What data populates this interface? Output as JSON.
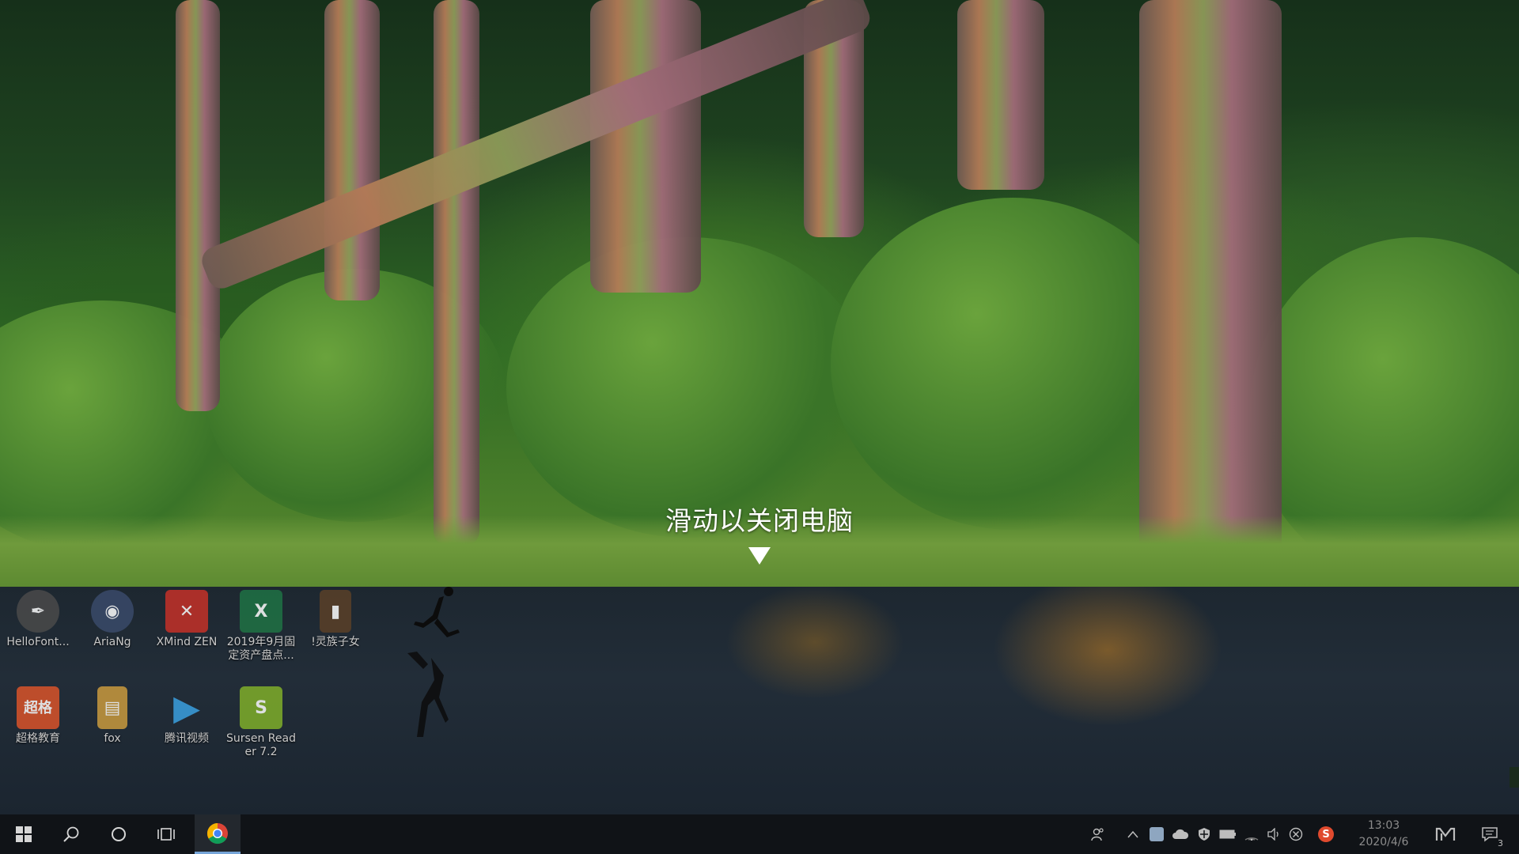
{
  "shutdown": {
    "prompt": "滑动以关闭电脑",
    "arrow_icon": "triangle-down-icon"
  },
  "desktop": {
    "icons": [
      {
        "label": "HelloFont...",
        "icon": "pen-nib-icon",
        "color": "#555555"
      },
      {
        "label": "AriaNg",
        "icon": "aria-mascot-icon",
        "color": "#3a4a6a"
      },
      {
        "label": "XMind ZEN",
        "icon": "xmind-icon",
        "color": "#d8322a"
      },
      {
        "label": "2019年9月固定资产盘点...",
        "icon": "excel-file-icon",
        "color": "#1f7244"
      },
      {
        "label": "!灵族子女",
        "icon": "book-icon",
        "color": "#6a5030"
      },
      {
        "label": "超格教育",
        "icon": "chaoge-app-icon",
        "color": "#e0552a",
        "tile_text": "超格"
      },
      {
        "label": "fox",
        "icon": "folder-icon",
        "color": "#d6a94a"
      },
      {
        "label": "腾讯视频",
        "icon": "tencent-video-icon",
        "color": "#2c8fd0"
      },
      {
        "label": "Sursen Reader 7.2",
        "icon": "sursen-reader-icon",
        "color": "#7fae2a",
        "tile_text": "S"
      }
    ]
  },
  "taskbar": {
    "start_icon": "windows-logo-icon",
    "search_icon": "search-icon",
    "cortana_icon": "cortana-circle-icon",
    "task_view_icon": "task-view-icon",
    "pinned_app_icon": "chrome-icon",
    "tray": {
      "people_icon": "people-icon",
      "chevron_icon": "chevron-up-icon",
      "icons": [
        "app-tray-icon",
        "onedrive-cloud-icon",
        "security-shield-icon",
        "battery-icon",
        "wifi-icon",
        "volume-icon",
        "blocked-icon",
        "sogou-ime-icon"
      ],
      "time": "13:03",
      "date": "2020/4/6",
      "ime_icon": "ime-m-icon",
      "notification_icon": "action-center-icon",
      "notification_count": "3"
    }
  },
  "colors": {
    "taskbar_bg": "#101317",
    "prompt_text": "#ffffff",
    "chrome_active_underline": "#76a5d8"
  }
}
